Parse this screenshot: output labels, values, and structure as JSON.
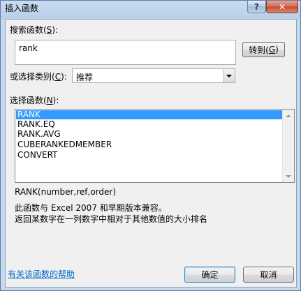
{
  "window": {
    "title": "插入函数",
    "help_label": "?",
    "close_label": "✕"
  },
  "search": {
    "label_prefix": "搜索函数(",
    "label_key": "S",
    "label_suffix": "):",
    "value": "rank"
  },
  "go_button": {
    "label_prefix": "转到(",
    "label_key": "G",
    "label_suffix": ")"
  },
  "category": {
    "label_prefix": "或选择类别(",
    "label_key": "C",
    "label_suffix": "):",
    "selected": "推荐"
  },
  "functions": {
    "label_prefix": "选择函数(",
    "label_key": "N",
    "label_suffix": "):",
    "items": [
      "RANK",
      "RANK.EQ",
      "RANK.AVG",
      "CUBERANKEDMEMBER",
      "CONVERT"
    ],
    "selected_index": 0
  },
  "description": {
    "signature": "RANK(number,ref,order)",
    "line1": "此函数与 Excel 2007 和早期版本兼容。",
    "line2": "返回某数字在一列数字中相对于其他数值的大小排名"
  },
  "help_link": "有关该函数的帮助",
  "ok_label": "确定",
  "cancel_label": "取消",
  "colors": {
    "selection": "#3399ff",
    "link": "#0066cc",
    "title_bar": "#b9cfe8"
  },
  "icons": {
    "help": "question-icon",
    "close": "close-icon",
    "dropdown": "chevron-down-icon"
  }
}
